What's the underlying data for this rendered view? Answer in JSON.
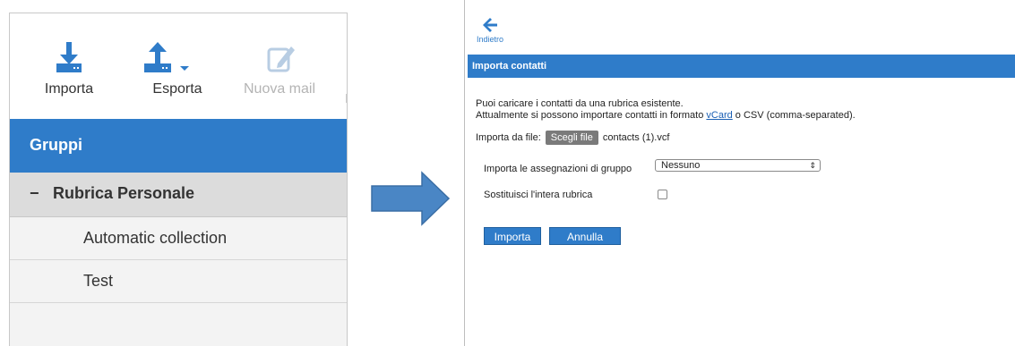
{
  "left_panel": {
    "toolbar": {
      "import_label": "Importa",
      "export_label": "Esporta",
      "new_mail_label": "Nuova mail"
    },
    "groups_header": "Gruppi",
    "group_root": {
      "toggle": "−",
      "label": "Rubrica Personale"
    },
    "group_items": [
      "Automatic collection",
      "Test"
    ]
  },
  "right_panel": {
    "back_label": "Indietro",
    "header": "Importa contatti",
    "info_line1": "Puoi caricare i contatti da una rubrica esistente.",
    "info_line2_prefix": "Attualmente si possono importare contatti in formato ",
    "info_link": "vCard",
    "info_line2_suffix": " o CSV (comma-separated).",
    "file_label": "Importa da file:",
    "choose_file_label": "Scegli file",
    "file_name": "contacts (1).vcf",
    "group_assign_label": "Importa le assegnazioni di gruppo",
    "group_assign_value": "Nessuno",
    "replace_label": "Sostituisci l'intera rubrica",
    "replace_checked": false,
    "import_button": "Importa",
    "cancel_button": "Annulla"
  },
  "colors": {
    "accent": "#2f7cc9",
    "arrow_fill": "#4a86c5",
    "disabled_text": "#b4b4b4"
  }
}
